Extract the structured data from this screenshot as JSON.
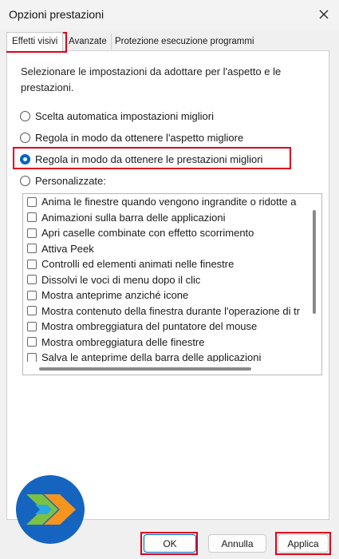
{
  "window": {
    "title": "Opzioni prestazioni"
  },
  "tabs": [
    {
      "label": "Effetti visivi",
      "selected": true
    },
    {
      "label": "Avanzate",
      "selected": false
    },
    {
      "label": "Protezione esecuzione programmi",
      "selected": false
    }
  ],
  "description": "Selezionare le impostazioni da adottare per l'aspetto e le prestazioni.",
  "options": [
    {
      "label": "Scelta automatica impostazioni migliori",
      "selected": false
    },
    {
      "label": "Regola in modo da ottenere l'aspetto migliore",
      "selected": false
    },
    {
      "label": "Regola in modo da ottenere le prestazioni migliori",
      "selected": true
    },
    {
      "label": "Personalizzate:",
      "selected": false
    }
  ],
  "effects": [
    {
      "label": "Anima le finestre quando vengono ingrandite o ridotte a",
      "checked": false
    },
    {
      "label": "Animazioni sulla barra delle applicazioni",
      "checked": false
    },
    {
      "label": "Apri caselle combinate con effetto scorrimento",
      "checked": false
    },
    {
      "label": "Attiva Peek",
      "checked": false
    },
    {
      "label": "Controlli ed elementi animati nelle finestre",
      "checked": false
    },
    {
      "label": "Dissolvi le voci di menu dopo il clic",
      "checked": false
    },
    {
      "label": "Mostra anteprime anziché icone",
      "checked": false
    },
    {
      "label": "Mostra contenuto della finestra durante l'operazione di tr",
      "checked": false
    },
    {
      "label": "Mostra ombreggiatura del puntatore del mouse",
      "checked": false
    },
    {
      "label": "Mostra ombreggiatura delle finestre",
      "checked": false
    },
    {
      "label": "Salva le anteprime della barra delle applicazioni",
      "checked": false
    }
  ],
  "buttons": {
    "ok": "OK",
    "cancel": "Annulla",
    "apply": "Applica"
  },
  "icons": {
    "close": "close-icon",
    "logo": "site-logo"
  },
  "colors": {
    "highlight": "#e0001b",
    "accent": "#0067c0",
    "logo_bg": "#1565c0",
    "logo_green": "#7cc242",
    "logo_orange": "#f7941d"
  }
}
